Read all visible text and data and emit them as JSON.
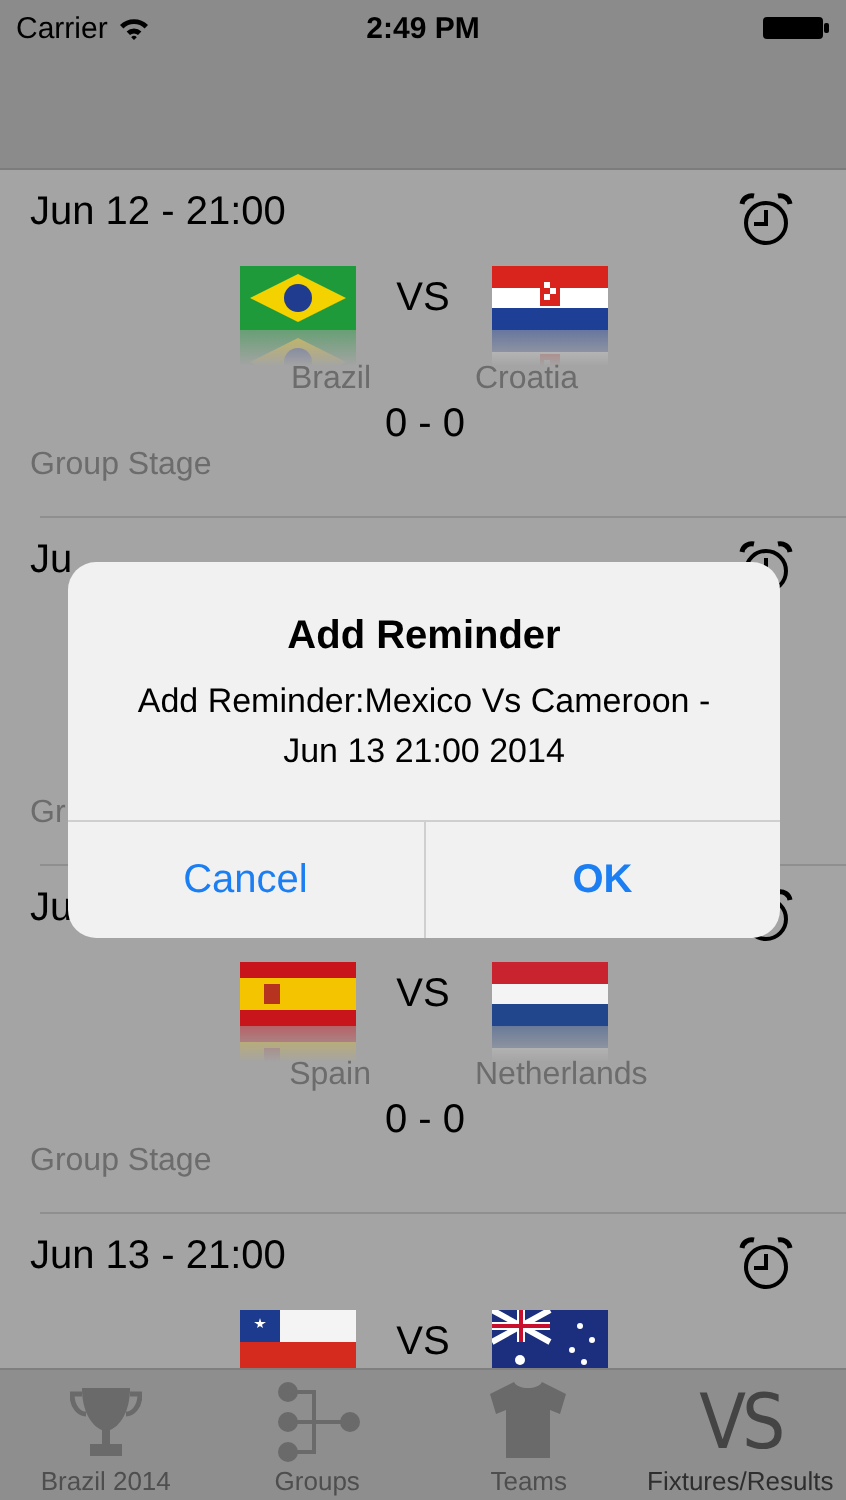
{
  "status_bar": {
    "carrier": "Carrier",
    "time": "2:49 PM"
  },
  "matches": [
    {
      "date": "Jun 12 - 21:00",
      "home": {
        "name": "Brazil"
      },
      "away": {
        "name": "Croatia"
      },
      "vs": "VS",
      "score": "0 - 0",
      "stage": "Group Stage"
    },
    {
      "date": "Ju",
      "stage": "Gr"
    },
    {
      "date": "Ju",
      "home": {
        "name": "Spain"
      },
      "away": {
        "name": "Netherlands"
      },
      "vs": "VS",
      "score": "0 - 0",
      "stage": "Group Stage"
    },
    {
      "date": "Jun 13 - 21:00",
      "vs": "VS"
    }
  ],
  "tabs": [
    {
      "label": "Brazil 2014",
      "selected": false
    },
    {
      "label": "Groups",
      "selected": false
    },
    {
      "label": "Teams",
      "selected": false
    },
    {
      "label": "Fixtures/Results",
      "icon_text": "VS",
      "selected": true
    }
  ],
  "alert": {
    "title": "Add Reminder",
    "message": "Add Reminder:Mexico  Vs Cameroon - Jun 13 21:00 2014",
    "buttons": [
      {
        "label": "Cancel",
        "kind": "cancel"
      },
      {
        "label": "OK",
        "kind": "default"
      }
    ]
  }
}
